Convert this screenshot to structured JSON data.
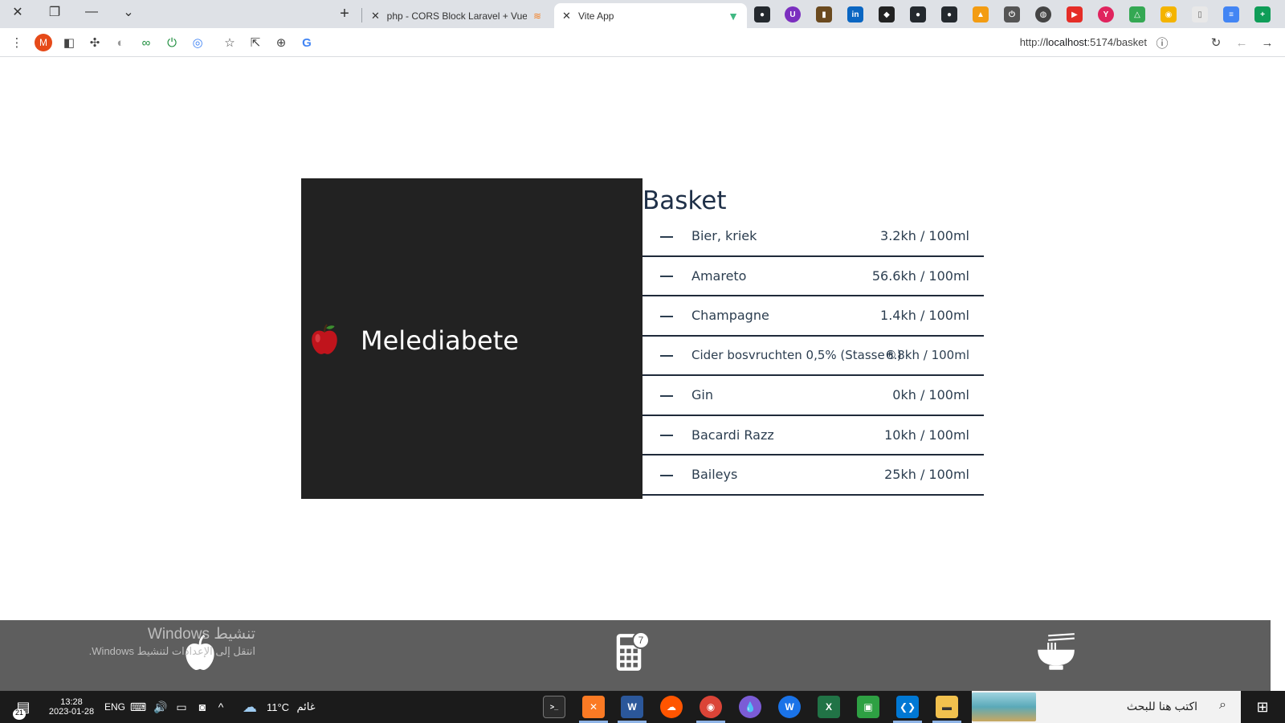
{
  "browser": {
    "tabs": [
      {
        "title": "php - CORS Block Laravel + Vue.",
        "active": false
      },
      {
        "title": "Vite App",
        "active": true
      }
    ],
    "url_prefix": "http://",
    "url_host": "localhost",
    "url_path": ":5174/basket",
    "profile_initial": "M"
  },
  "hero": {
    "brand": "Melediabete",
    "accent": "#222222"
  },
  "basket": {
    "title": "Basket",
    "items": [
      {
        "name": "Bier, kriek",
        "kh": "3.2kh / 100ml"
      },
      {
        "name": "Amareto",
        "kh": "56.6kh / 100ml"
      },
      {
        "name": "Champagne",
        "kh": "1.4kh / 100ml"
      },
      {
        "name": "Cider bosvruchten 0,5% (Stasse®)",
        "kh": "6.8kh / 100ml"
      },
      {
        "name": "Gin",
        "kh": "0kh / 100ml"
      },
      {
        "name": "Bacardi Razz",
        "kh": "10kh / 100ml"
      },
      {
        "name": "Baileys",
        "kh": "25kh / 100ml"
      }
    ]
  },
  "bottom_nav": {
    "items": [
      {
        "icon": "apple-icon"
      },
      {
        "icon": "calculator-icon",
        "badge": "7"
      },
      {
        "icon": "noodle-bowl-icon"
      }
    ]
  },
  "activation": {
    "line1": "تنشيط Windows",
    "line2": "انتقل إلى الإعدادات لتنشيط Windows."
  },
  "taskbar": {
    "time": "13:28",
    "date": "2023-01-28",
    "lang": "ENG",
    "temperature": "11°C",
    "weather": "غائم",
    "search_placeholder": "اكتب هنا للبحث",
    "notification_count": "21"
  }
}
